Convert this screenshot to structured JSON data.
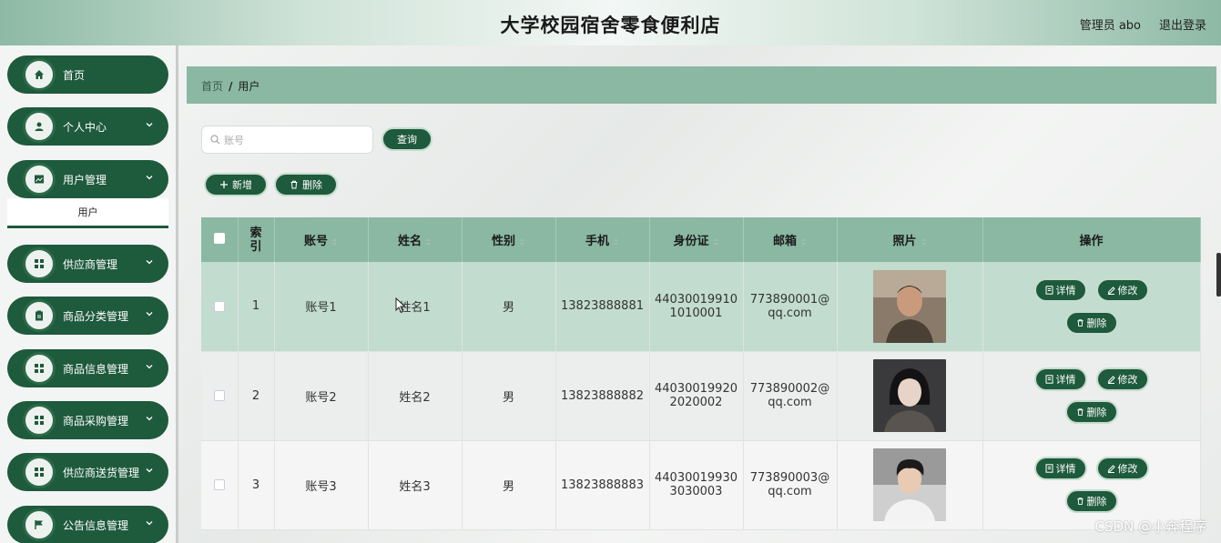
{
  "header": {
    "title": "大学校园宿舍零食便利店",
    "admin": "管理员 abo",
    "logout": "退出登录"
  },
  "sidebar": {
    "items": [
      {
        "label": "首页",
        "icon": "home-icon"
      },
      {
        "label": "个人中心",
        "icon": "user-icon"
      },
      {
        "label": "用户管理",
        "icon": "image-icon"
      },
      {
        "label": "供应商管理",
        "icon": "grid-icon"
      },
      {
        "label": "商品分类管理",
        "icon": "clipboard-icon"
      },
      {
        "label": "商品信息管理",
        "icon": "grid-icon"
      },
      {
        "label": "商品采购管理",
        "icon": "grid-icon"
      },
      {
        "label": "供应商送货管理",
        "icon": "grid-icon"
      },
      {
        "label": "公告信息管理",
        "icon": "flag-icon"
      }
    ],
    "submenu": {
      "label": "用户"
    }
  },
  "breadcrumb": {
    "home": "首页",
    "separator": "/",
    "current": "用户"
  },
  "search": {
    "placeholder": "账号",
    "value": "",
    "button": "查询"
  },
  "toolbar": {
    "add": "新增",
    "delete": "删除"
  },
  "table": {
    "headers": [
      "索引",
      "账号",
      "姓名",
      "性别",
      "手机",
      "身份证",
      "邮箱",
      "照片",
      "操作"
    ],
    "index_header": [
      "索",
      "引"
    ],
    "rows": [
      {
        "index": "1",
        "account": "账号1",
        "name": "姓名1",
        "gender": "男",
        "phone": "13823888881",
        "id_line1": "44030019910",
        "id_line2": "1010001",
        "email_line1": "773890001@",
        "email_line2": "qq.com",
        "photo": "portrait-1"
      },
      {
        "index": "2",
        "account": "账号2",
        "name": "姓名2",
        "gender": "男",
        "phone": "13823888882",
        "id_line1": "44030019920",
        "id_line2": "2020002",
        "email_line1": "773890002@",
        "email_line2": "qq.com",
        "photo": "portrait-2"
      },
      {
        "index": "3",
        "account": "账号3",
        "name": "姓名3",
        "gender": "男",
        "phone": "13823888883",
        "id_line1": "44030019930",
        "id_line2": "3030003",
        "email_line1": "773890003@",
        "email_line2": "qq.com",
        "photo": "portrait-3"
      }
    ],
    "actions": {
      "detail": "详情",
      "edit": "修改",
      "delete": "删除"
    }
  },
  "watermark": "CSDN @小奔程序",
  "colors": {
    "accent": "#1e5a3c",
    "header_band": "#8ab8a2",
    "selected_row": "#c2dccf"
  }
}
